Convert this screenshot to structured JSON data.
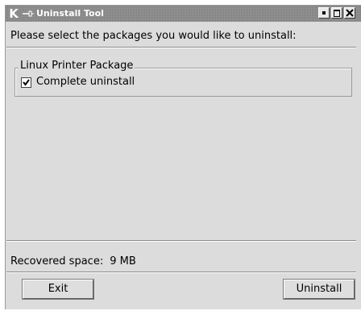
{
  "window": {
    "title": "Uninstall Tool",
    "logo": "K",
    "controls": [
      "minimize-icon",
      "maximize-icon",
      "close-icon"
    ]
  },
  "instruction": "Please select the packages you would like to uninstall:",
  "package_group": {
    "title": "Linux Printer Package",
    "options": [
      {
        "label": "Complete uninstall",
        "checked": true
      }
    ]
  },
  "status": {
    "label": "Recovered space:",
    "value": "9 MB"
  },
  "buttons": {
    "exit": "Exit",
    "uninstall": "Uninstall"
  }
}
